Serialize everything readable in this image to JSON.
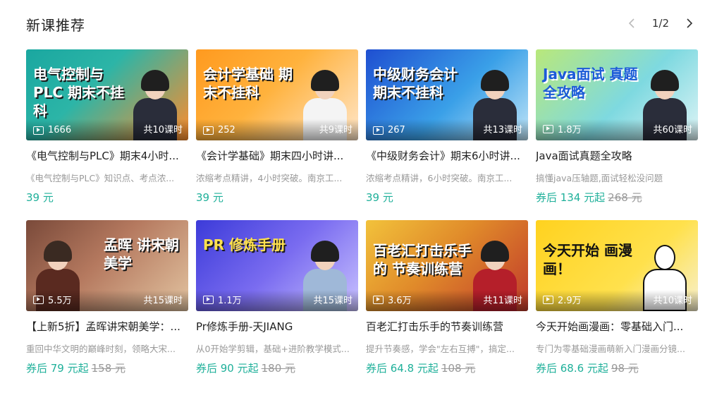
{
  "section": {
    "title": "新课推荐"
  },
  "pager": {
    "text": "1/2"
  },
  "colors": {
    "accent": "#1fb09a",
    "muted": "#999999"
  },
  "cards": [
    {
      "headline": "电气控制与PLC 期末不挂科",
      "views": "1666",
      "lessons": "共10课时",
      "title": "《电气控制与PLC》期末4小时...",
      "desc": "《电气控制与PLC》知识点、考点浓...",
      "price": "39 元",
      "orig_price": "",
      "bg": "linear-gradient(135deg,#1aa7a0 0%,#2cb5a7 40%,#ff8c2b 100%)"
    },
    {
      "headline": "会计学基础 期末不挂科",
      "views": "252",
      "lessons": "共9课时",
      "title": "《会计学基础》期末四小时讲...",
      "desc": "浓缩考点精讲，4小时突破。南京工...",
      "price": "39 元",
      "orig_price": "",
      "bg": "linear-gradient(135deg,#ff9a1f 0%,#ffb23d 45%,#ffe6c9 100%)"
    },
    {
      "headline": "中级财务会计 期末不挂科",
      "views": "267",
      "lessons": "共13课时",
      "title": "《中级财务会计》期末6小时讲...",
      "desc": "浓缩考点精讲，6小时突破。南京工...",
      "price": "39 元",
      "orig_price": "",
      "bg": "linear-gradient(135deg,#1f4fd1 0%,#3aa0e8 55%,#bfe4f7 100%)"
    },
    {
      "headline": "Java面试 真题全攻略",
      "views": "1.8万",
      "lessons": "共60课时",
      "title": "Java面试真题全攻略",
      "desc": "搞懂java压轴题,面试轻松没问题",
      "price": "券后 134 元起",
      "orig_price": "268 元",
      "bg": "linear-gradient(135deg,#b9e87a 0%,#7ed9e0 55%,#dff4f6 100%)"
    },
    {
      "headline": "孟晖 讲宋朝美学",
      "views": "5.5万",
      "lessons": "共15课时",
      "title": "【上新5折】孟晖讲宋朝美学：...",
      "desc": "重回中华文明的巅峰时刻，领略大宋...",
      "price": "券后 79 元起",
      "orig_price": "158 元",
      "bg": "linear-gradient(135deg,#7a4a3a 0%,#b5795f 45%,#e2c3a0 100%)"
    },
    {
      "headline": "PR 修炼手册",
      "views": "1.1万",
      "lessons": "共15课时",
      "title": "Pr修炼手册-天JIANG",
      "desc": "从0开始学剪辑，基础+进阶教学模式...",
      "price": "券后 90 元起",
      "orig_price": "180 元",
      "bg": "linear-gradient(135deg,#3c3bd9 0%,#7a6cf0 50%,#c9c2ff 100%)"
    },
    {
      "headline": "百老汇打击乐手的 节奏训练营",
      "views": "3.6万",
      "lessons": "共11课时",
      "title": "百老汇打击乐手的节奏训练营",
      "desc": "提升节奏感，学会\"左右互搏\"，搞定...",
      "price": "券后 64.8 元起",
      "orig_price": "108 元",
      "bg": "linear-gradient(135deg,#f2c23b 0%,#e08a2a 45%,#c0392b 100%)"
    },
    {
      "headline": "今天开始 画漫画！",
      "views": "2.9万",
      "lessons": "共10课时",
      "title": "今天开始画漫画：零基础入门...",
      "desc": "专门为零基础漫画萌新入门漫画分镜...",
      "price": "券后 68.6 元起",
      "orig_price": "98 元",
      "bg": "linear-gradient(135deg,#ffd21f 0%,#ffe14d 60%,#f7f0d0 100%)"
    }
  ]
}
